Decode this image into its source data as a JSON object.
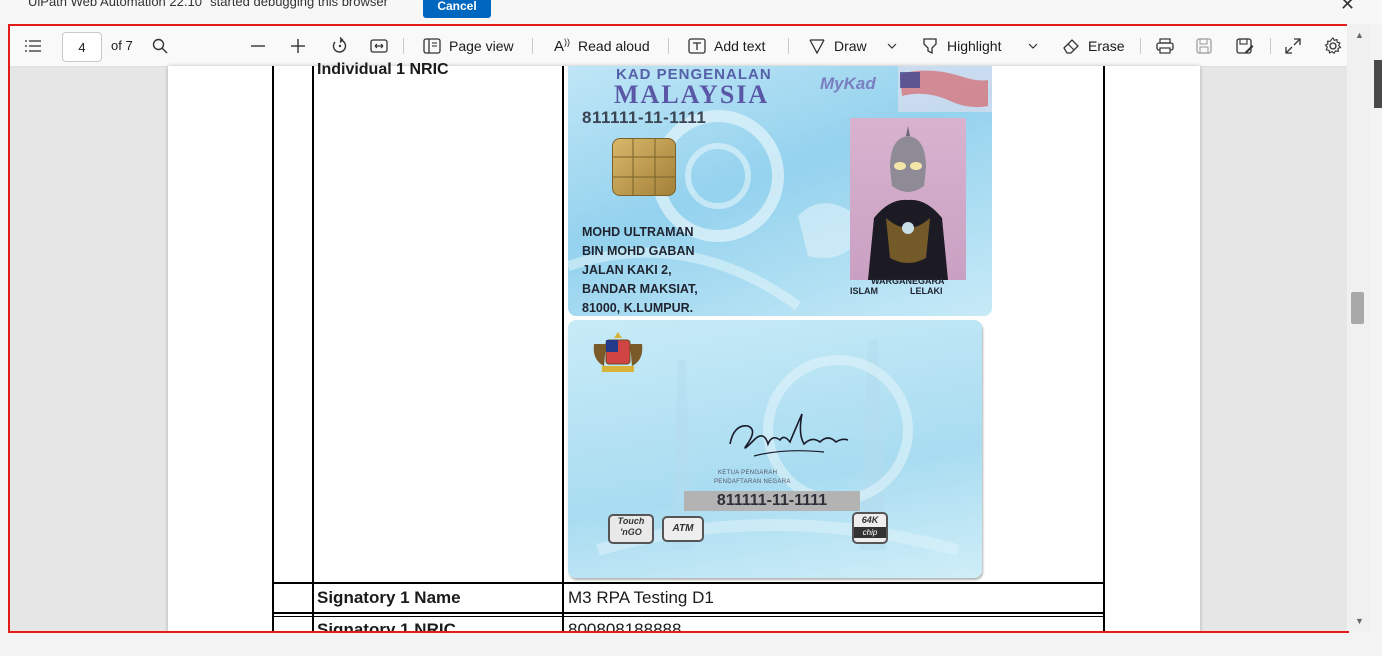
{
  "infobar": {
    "message": "UiPath Web Automation 22.10\" started debugging this browser",
    "cancel_label": "Cancel"
  },
  "toolbar": {
    "page_number": "4",
    "page_total": "of 7",
    "page_view_label": "Page view",
    "read_aloud_label": "Read aloud",
    "add_text_label": "Add text",
    "draw_label": "Draw",
    "highlight_label": "Highlight",
    "erase_label": "Erase"
  },
  "table": {
    "rows": [
      {
        "label": "Individual 1 NRIC",
        "value": ""
      },
      {
        "label": "Signatory 1 Name",
        "value": "M3 RPA Testing D1"
      },
      {
        "label": "Signatory 1 NRIC",
        "value": "800808188888"
      }
    ]
  },
  "id_front": {
    "kad": "KAD PENGENALAN",
    "country": "MALAYSIA",
    "brand": "MyKad",
    "id_number": "811111-11-1111",
    "address": "MOHD ULTRAMAN\nBIN MOHD GABAN\nJALAN KAKI 2,\nBANDAR MAKSIAT,\n81000, K.LUMPUR.",
    "citizenship": "WARGANEGARA",
    "religion": "ISLAM",
    "gender": "LELAKI"
  },
  "id_back": {
    "officer_title": "KETUA PENGARAH",
    "department": "PENDAFTARAN NEGARA",
    "id_number": "811111-11-1111",
    "touchngo": "Touch 'nGO",
    "atm": "ATM",
    "chip_size": "64K",
    "chip_label": "chip"
  },
  "icons": [
    "contents-icon",
    "search-icon",
    "zoom-out-icon",
    "zoom-in-icon",
    "rotate-icon",
    "fit-width-icon",
    "page-view-icon",
    "read-aloud-icon",
    "add-text-icon",
    "draw-icon",
    "highlight-icon",
    "erase-icon",
    "print-icon",
    "save-icon",
    "save-as-icon",
    "fullscreen-icon",
    "settings-icon"
  ],
  "colors": {
    "highlight_border": "#e21c1c",
    "cancel_button": "#0067c0"
  }
}
